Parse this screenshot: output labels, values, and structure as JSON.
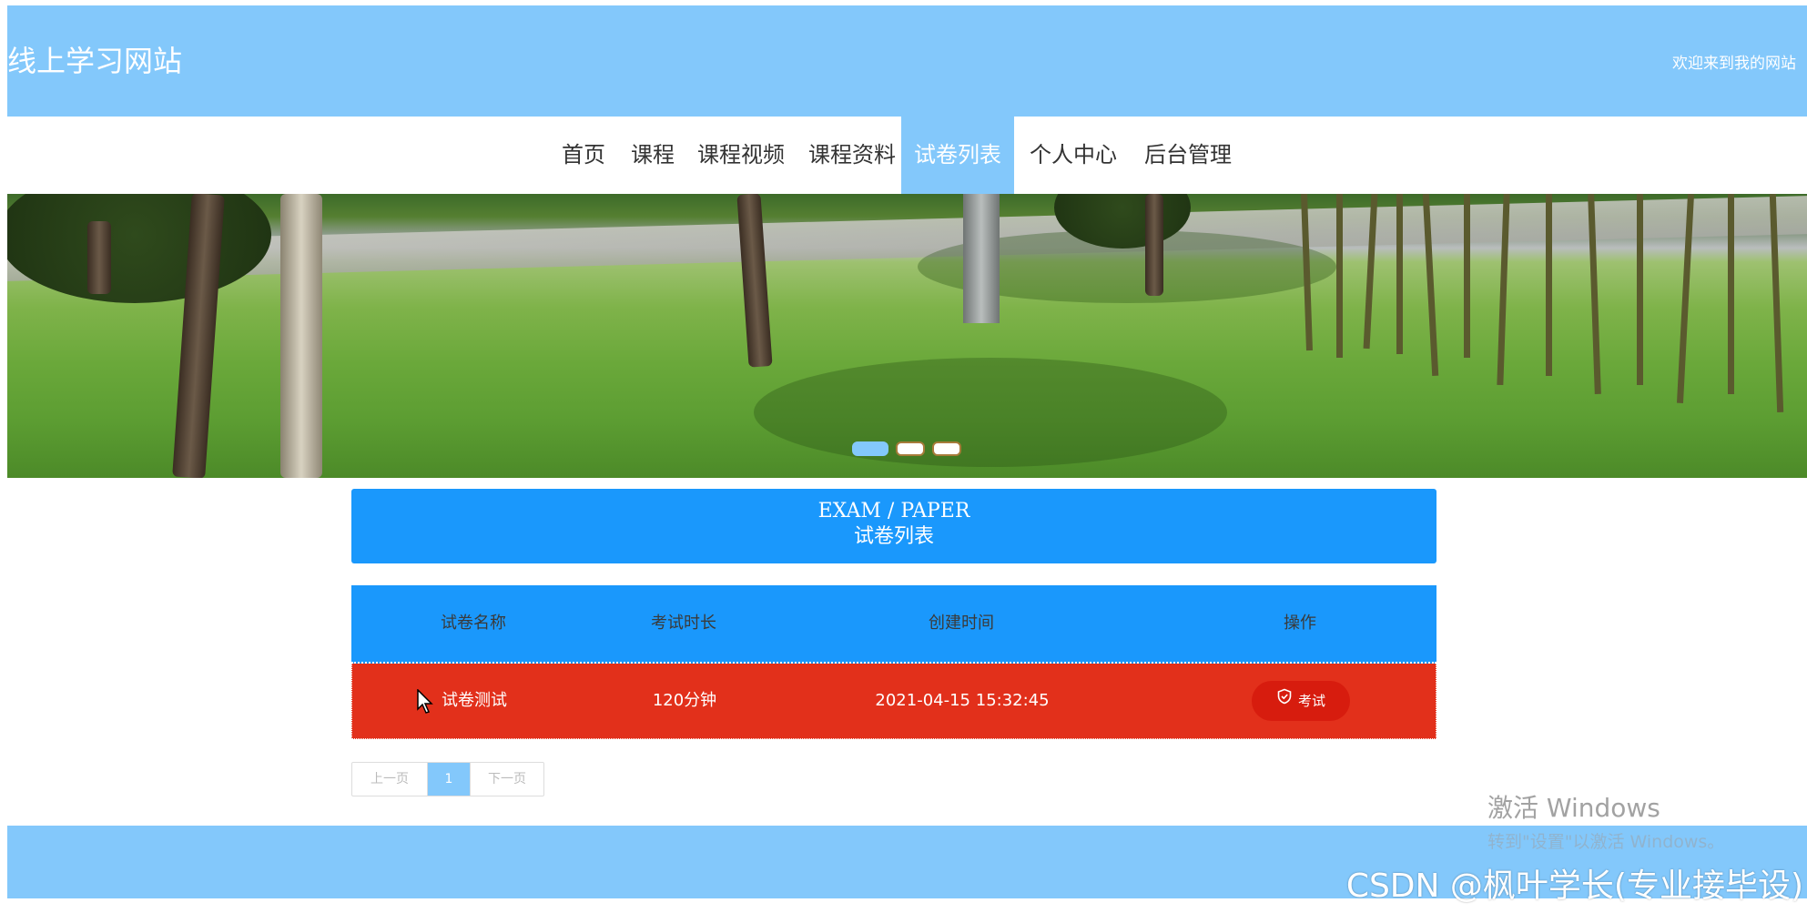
{
  "header": {
    "site_title": "线上学习网站",
    "welcome": "欢迎来到我的网站"
  },
  "nav": {
    "items": [
      {
        "label": "首页"
      },
      {
        "label": "课程"
      },
      {
        "label": "课程视频"
      },
      {
        "label": "课程资料"
      },
      {
        "label": "试卷列表",
        "active": true
      },
      {
        "label": "个人中心"
      },
      {
        "label": "后台管理"
      }
    ]
  },
  "banner": {
    "slide_count": 3,
    "active_slide": 1
  },
  "section": {
    "title_en": "EXAM / PAPER",
    "title_zh": "试卷列表"
  },
  "table": {
    "headers": [
      "试卷名称",
      "考试时长",
      "创建时间",
      "操作"
    ],
    "rows": [
      {
        "name": "试卷测试",
        "duration": "120分钟",
        "created": "2021-04-15 15:32:45",
        "action": "考试"
      }
    ]
  },
  "pagination": {
    "prev": "上一页",
    "current": "1",
    "next": "下一页"
  },
  "overlay": {
    "windows_activate": "激活 Windows",
    "windows_activate_sub": "转到\"设置\"以激活 Windows。",
    "watermark": "CSDN @枫叶学长(专业接毕设)"
  },
  "colors": {
    "header_bg": "#83c8fb",
    "section_bg": "#1a98fc",
    "row_bg": "#e2301b",
    "button_bg": "#d71c0e"
  }
}
